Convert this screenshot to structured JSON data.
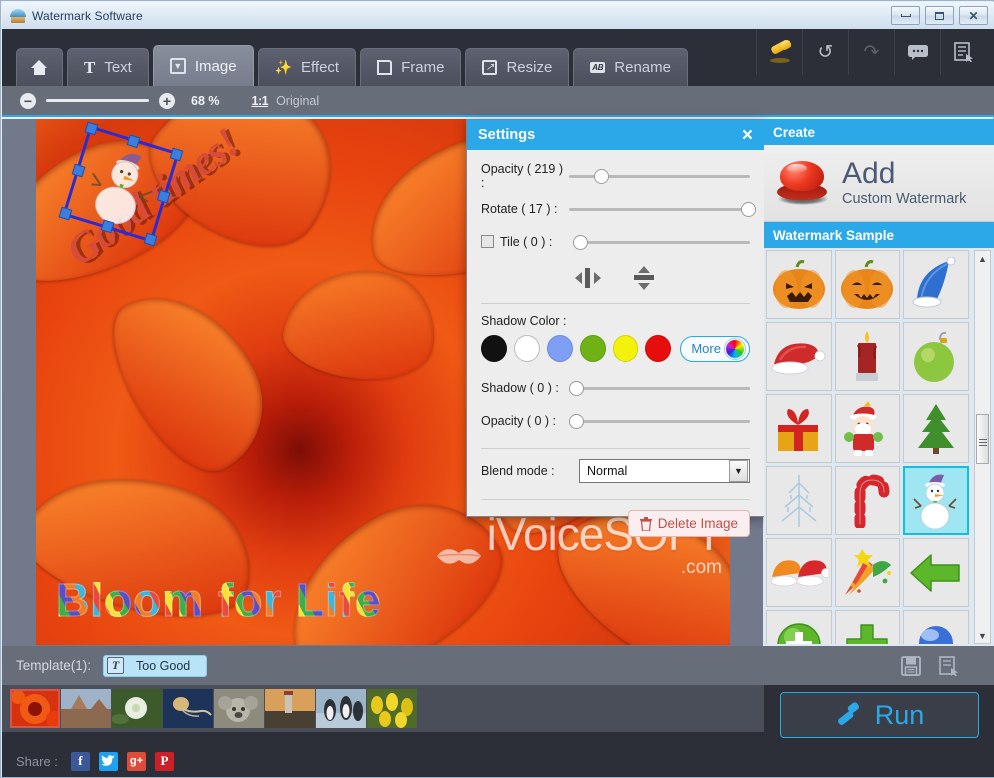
{
  "window": {
    "title": "Watermark Software",
    "icon": "umbrella-icon",
    "controls": {
      "minimize": "minimize-button",
      "maximize": "maximize-button",
      "close": "close-button"
    }
  },
  "tabs": [
    {
      "id": "home",
      "label": "",
      "icon": "home-icon",
      "active": false
    },
    {
      "id": "text",
      "label": "Text",
      "icon": "text-t-icon",
      "active": false
    },
    {
      "id": "image",
      "label": "Image",
      "icon": "image-icon",
      "active": true
    },
    {
      "id": "effect",
      "label": "Effect",
      "icon": "wand-icon",
      "active": false
    },
    {
      "id": "frame",
      "label": "Frame",
      "icon": "frame-icon",
      "active": false
    },
    {
      "id": "resize",
      "label": "Resize",
      "icon": "resize-icon",
      "active": false
    },
    {
      "id": "rename",
      "label": "Rename",
      "icon": "ab-icon",
      "active": false
    }
  ],
  "toolbar_icons": [
    {
      "id": "stamp",
      "name": "stamp-icon",
      "glyph": ""
    },
    {
      "id": "undo",
      "name": "undo-icon",
      "glyph": "↺"
    },
    {
      "id": "redo",
      "name": "redo-icon",
      "glyph": "↷"
    },
    {
      "id": "feedback",
      "name": "comment-icon",
      "glyph": "💬"
    },
    {
      "id": "list",
      "name": "list-select-icon",
      "glyph": "▤"
    }
  ],
  "zoombar": {
    "zoom_out": "zoom-out-icon",
    "zoom_in": "zoom-in-icon",
    "percent": "68 %",
    "one_to_one": "1:1",
    "original": "Original"
  },
  "canvas": {
    "watermarks": {
      "text_top": "Good times!",
      "text_bottom": "Bloom for Life",
      "brand": "iVoiceSOFT",
      "brand_suffix": ".com",
      "selected_object": "snowman-watermark"
    }
  },
  "settings_dialog": {
    "title": "Settings",
    "close": "×",
    "opacity_label": "Opacity ( 219 ) :",
    "opacity_value": 219,
    "opacity_pct": 14,
    "rotate_label": "Rotate ( 17 ) :",
    "rotate_value": 17,
    "rotate_pct": 97,
    "tile_label": "Tile ( 0 ) :",
    "tile_value": 0,
    "tile_pct": 0,
    "tile_checked": false,
    "flip_horizontal": "flip-horizontal-icon",
    "flip_vertical": "flip-vertical-icon",
    "shadow_color_label": "Shadow Color :",
    "swatches": [
      "#111111",
      "#ffffff",
      "#7f9ef5",
      "#6fb216",
      "#f2f20a",
      "#e80d0d"
    ],
    "more_label": "More",
    "shadow_label": "Shadow ( 0 ) :",
    "shadow_value": 0,
    "shadow_pct": 0,
    "shadow_opacity_label": "Opacity ( 0 ) :",
    "shadow_opacity_value": 0,
    "shadow_opacity_pct": 0,
    "blend_label": "Blend mode :",
    "blend_value": "Normal",
    "delete_label": "Delete Image"
  },
  "right_panel": {
    "create_header": "Create",
    "add_title": "Add",
    "add_subtitle": "Custom Watermark",
    "sample_header": "Watermark Sample",
    "samples": [
      {
        "name": "pumpkin-scary-icon",
        "selected": false
      },
      {
        "name": "pumpkin-happy-icon",
        "selected": false
      },
      {
        "name": "blue-santa-hat-icon",
        "selected": false
      },
      {
        "name": "red-santa-hat-icon",
        "selected": false
      },
      {
        "name": "candle-icon",
        "selected": false
      },
      {
        "name": "green-ornament-icon",
        "selected": false
      },
      {
        "name": "gift-box-icon",
        "selected": false
      },
      {
        "name": "santa-claus-icon",
        "selected": false
      },
      {
        "name": "christmas-tree-icon",
        "selected": false
      },
      {
        "name": "snow-tree-outline-icon",
        "selected": false
      },
      {
        "name": "candy-cane-icon",
        "selected": false
      },
      {
        "name": "snowman-icon",
        "selected": true
      },
      {
        "name": "two-santa-hats-icon",
        "selected": false
      },
      {
        "name": "fireworks-icon",
        "selected": false
      },
      {
        "name": "green-arrow-left-icon",
        "selected": false
      },
      {
        "name": "green-plus-circle-icon",
        "selected": false
      },
      {
        "name": "green-cross-icon",
        "selected": false
      },
      {
        "name": "blue-sphere-icon",
        "selected": false
      }
    ],
    "scroll_up": "scroll-up-arrow",
    "scroll_down": "scroll-down-arrow"
  },
  "bottom": {
    "template_label": "Template(1):",
    "template_chip": "Too Good",
    "template_chip_icon": "text-t-icon",
    "save_icon": "save-icon",
    "save_as_icon": "save-as-icon",
    "run_label": "Run",
    "run_icon": "stamp-icon",
    "thumbnails": [
      {
        "name": "thumb-red-flower",
        "selected": true
      },
      {
        "name": "thumb-desert"
      },
      {
        "name": "thumb-white-flower"
      },
      {
        "name": "thumb-jellyfish"
      },
      {
        "name": "thumb-koala"
      },
      {
        "name": "thumb-lighthouse"
      },
      {
        "name": "thumb-penguins"
      },
      {
        "name": "thumb-tulips"
      }
    ],
    "share_label": "Share :",
    "share": [
      {
        "id": "facebook",
        "glyph": "f",
        "color": "#3b5998"
      },
      {
        "id": "twitter",
        "glyph": "t",
        "color": "#1da1f2"
      },
      {
        "id": "googleplus",
        "glyph": "g+",
        "color": "#dd4b39"
      },
      {
        "id": "pinterest",
        "glyph": "P",
        "color": "#cb2027"
      }
    ]
  },
  "colors": {
    "accent": "#2aa8e8",
    "toolbar_bg": "#686d7a",
    "dark_bg": "#2c2f38",
    "canvas_bg": "#72798a",
    "selection": "#13bde0"
  }
}
